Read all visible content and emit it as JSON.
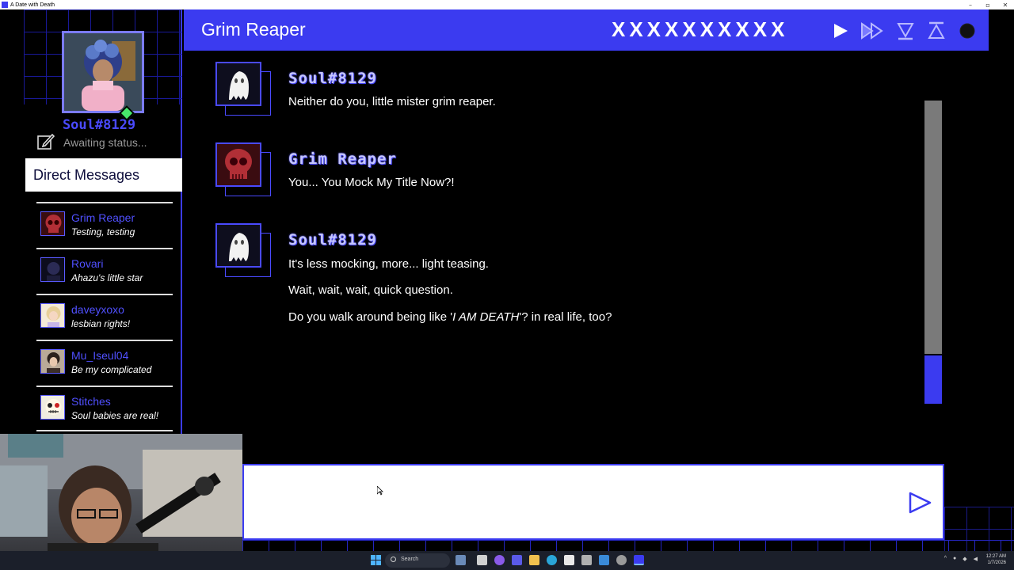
{
  "window": {
    "title": "A Date with Death",
    "controls": [
      "–",
      "▫",
      "✕"
    ]
  },
  "profile": {
    "name": "Soul#8129",
    "status": "Awaiting status..."
  },
  "sidebar": {
    "dm_header": "Direct Messages",
    "items": [
      {
        "name": "Grim Reaper",
        "preview": "Testing, testing",
        "avatar": "skull-avatar",
        "color": "#b12f36"
      },
      {
        "name": "Rovari",
        "preview": "Ahazu's little star",
        "avatar": "dark-avatar",
        "color": "#1d1d3a"
      },
      {
        "name": "daveyxoxo",
        "preview": "lesbian rights!",
        "avatar": "blonde-avatar",
        "color": "#e7cf9a"
      },
      {
        "name": "Mu_Iseul04",
        "preview": "Be my complicated",
        "avatar": "dark-hair-avatar",
        "color": "#3c2e28"
      },
      {
        "name": "Stitches",
        "preview": "Soul babies are real!",
        "avatar": "stitches-avatar",
        "color": "#f0ede0"
      }
    ]
  },
  "header": {
    "title": "Grim Reaper",
    "strikes": "XXXXXXXXXX",
    "buttons": [
      "play-icon",
      "fast-forward-icon",
      "skip-down-icon",
      "skip-up-icon",
      "record-icon"
    ]
  },
  "messages": [
    {
      "author": "Soul#8129",
      "avatar": "ghost-icon",
      "lines": [
        "Neither do you, little mister grim reaper."
      ]
    },
    {
      "author": "Grim Reaper",
      "avatar": "skull-icon",
      "lines": [
        "You... You Mock My Title Now?!"
      ]
    },
    {
      "author": "Soul#8129",
      "avatar": "ghost-icon",
      "lines": [
        "It's less mocking, more... light teasing.",
        "Wait, wait, wait, quick question."
      ],
      "last_line": {
        "before": "Do you walk around being like '",
        "emph": "I AM DEATH",
        "after": "'? in real life, too?"
      }
    }
  ],
  "input": {
    "value": "",
    "placeholder": ""
  },
  "scrollbar": {
    "position": 0.84
  },
  "taskbar": {
    "search_label": "Search",
    "clock_time": "12:27 AM",
    "clock_date": "1/7/2026"
  },
  "colors": {
    "accent": "#3b3bf0",
    "name": "#4a4aff",
    "online": "#47e86b"
  }
}
